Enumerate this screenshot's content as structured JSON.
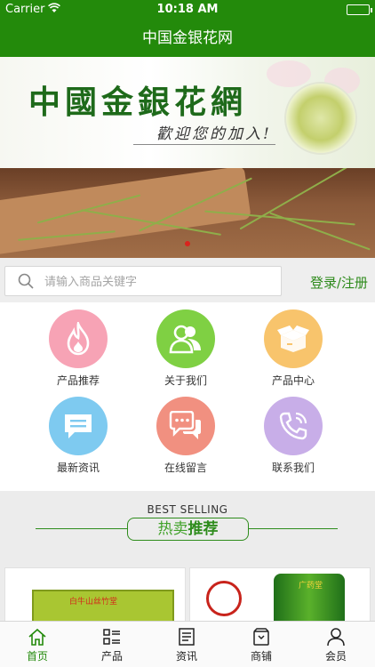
{
  "status_bar": {
    "carrier": "Carrier",
    "time": "10:18 AM"
  },
  "navbar": {
    "title": "中国金银花网"
  },
  "banner": {
    "title": "中國金銀花網",
    "subtitle": "歡迎您的加入!"
  },
  "search": {
    "placeholder": "请输入商品关键字",
    "login_label": "登录/注册"
  },
  "grid": [
    {
      "label": "产品推荐",
      "icon": "flame-icon",
      "color": "#f7a3b5"
    },
    {
      "label": "关于我们",
      "icon": "users-icon",
      "color": "#7fd043"
    },
    {
      "label": "产品中心",
      "icon": "box-icon",
      "color": "#f8c46c"
    },
    {
      "label": "最新资讯",
      "icon": "message-icon",
      "color": "#7ecaf0"
    },
    {
      "label": "在线留言",
      "icon": "chat-icon",
      "color": "#f19080"
    },
    {
      "label": "联系我们",
      "icon": "phone-icon",
      "color": "#c8aee8"
    }
  ],
  "section": {
    "en": "BEST SELLING",
    "zh_a": "热卖",
    "zh_b": "推荐"
  },
  "products": [
    {
      "label": "白牛山丝竹堂"
    },
    {
      "label": "广药堂"
    }
  ],
  "tabbar": [
    {
      "label": "首页",
      "icon": "home-icon",
      "active": true
    },
    {
      "label": "产品",
      "icon": "grid-list-icon",
      "active": false
    },
    {
      "label": "资讯",
      "icon": "news-icon",
      "active": false
    },
    {
      "label": "商铺",
      "icon": "store-icon",
      "active": false
    },
    {
      "label": "会员",
      "icon": "user-icon",
      "active": false
    }
  ],
  "colors": {
    "brand": "#238a0b",
    "accent_red": "#d9231d"
  }
}
